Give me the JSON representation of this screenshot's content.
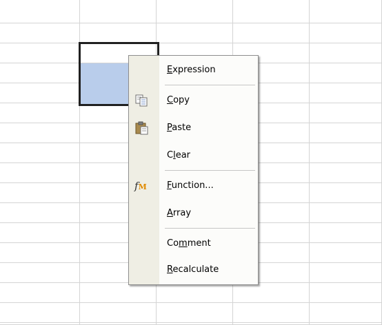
{
  "context_menu": {
    "items": [
      {
        "label": "Expression",
        "mnemonic": "E",
        "icon": null
      },
      {
        "label": "Copy",
        "mnemonic": "C",
        "icon": "copy-icon"
      },
      {
        "label": "Paste",
        "mnemonic": "P",
        "icon": "paste-icon"
      },
      {
        "label": "Clear",
        "mnemonic": "l",
        "icon": null
      },
      {
        "label": "Function...",
        "mnemonic": "F",
        "icon": "function-icon"
      },
      {
        "label": "Array",
        "mnemonic": "A",
        "icon": null
      },
      {
        "label": "Comment",
        "mnemonic": "m",
        "icon": null
      },
      {
        "label": "Recalculate",
        "mnemonic": "R",
        "icon": null
      }
    ]
  },
  "function_icon_text": "fм",
  "colors": {
    "grid_line": "#d4d4d4",
    "selected_cell": "#b9cdeb",
    "menu_gutter": "#efeee4",
    "menu_border": "#8d8d8d"
  }
}
